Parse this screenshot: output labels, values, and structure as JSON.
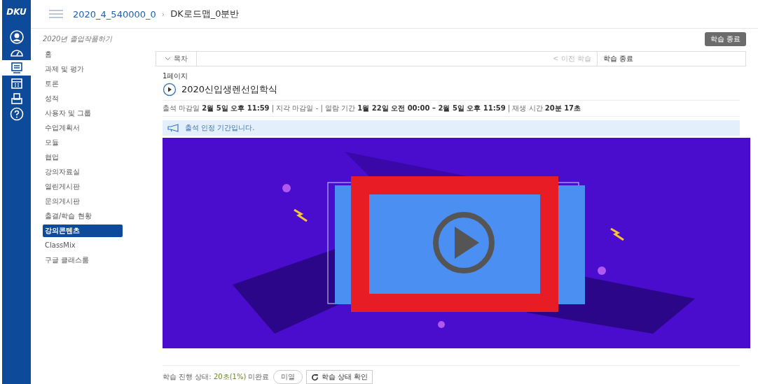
{
  "rail": {
    "logo": "DKU",
    "items": [
      {
        "kind": "user",
        "selected": false
      },
      {
        "kind": "dashboard",
        "selected": false
      },
      {
        "kind": "courses",
        "selected": true
      },
      {
        "kind": "calendar",
        "selected": false
      },
      {
        "kind": "inbox",
        "selected": false
      },
      {
        "kind": "help",
        "selected": false
      }
    ]
  },
  "breadcrumb": {
    "course": "2020_4_540000_0",
    "separator": "›",
    "page": "DK로드맵_0분반"
  },
  "sidebar": {
    "term": "2020년 졸업작품하기",
    "items": [
      {
        "label": "홈",
        "selected": false
      },
      {
        "label": "과제 및 평가",
        "selected": false
      },
      {
        "label": "토론",
        "selected": false
      },
      {
        "label": "성적",
        "selected": false
      },
      {
        "label": "사용자 및 그룹",
        "selected": false
      },
      {
        "label": "수업계획서",
        "selected": false
      },
      {
        "label": "모듈",
        "selected": false
      },
      {
        "label": "협업",
        "selected": false
      },
      {
        "label": "강의자료실",
        "selected": false
      },
      {
        "label": "열린게시판",
        "selected": false
      },
      {
        "label": "문의게시판",
        "selected": false
      },
      {
        "label": "출결/학습 현황",
        "selected": false
      },
      {
        "label": "강의콘텐츠",
        "selected": true
      },
      {
        "label": "ClassMix",
        "selected": false
      },
      {
        "label": "구글 클래스룸",
        "selected": false
      }
    ]
  },
  "end_button": "학습 종료",
  "toolbar": {
    "toc": "목차",
    "prev": "< 이전 학습",
    "next": "학습 종료"
  },
  "page_label": "1페이지",
  "title": "2020신입생렌선입학식",
  "meta": "출석 마감일 **2월 5일 오후 11:59** | 지각 마감일 - | 열람 기간 **1월 22일 오전 00:00 – 2월 5일 오후 11:59** | 재생 시간 **20분 17초**",
  "notice": "출석 인정 기간입니다.",
  "status": {
    "label": "학습 진행 상태:",
    "progress": "20초(1%)",
    "state": "미완료",
    "badge": "미열",
    "check_button": "학습 상태 확인"
  }
}
